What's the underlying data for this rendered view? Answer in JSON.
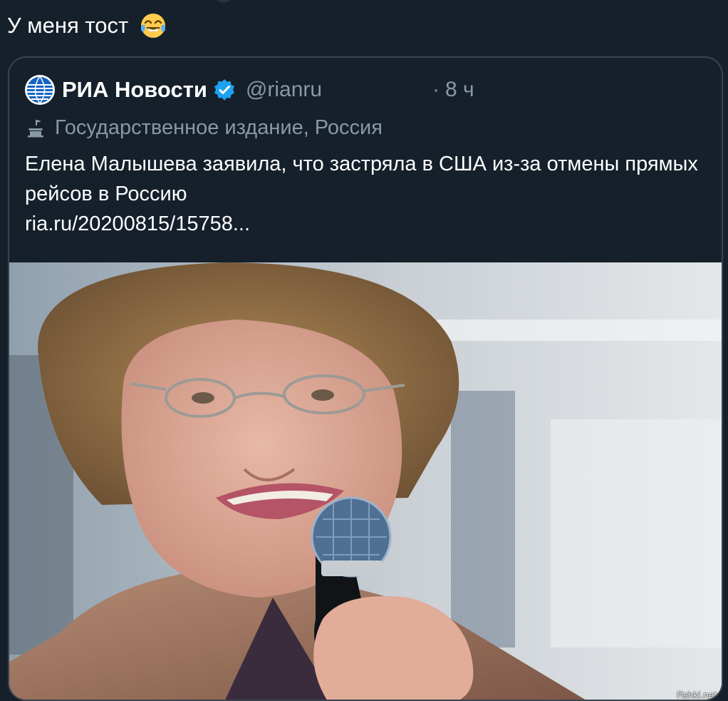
{
  "tweet": {
    "text": "У меня тост",
    "emoji": "face-with-tears-of-joy-emoji"
  },
  "quoted_tweet": {
    "author_name": "РИА Новости",
    "verified": true,
    "handle": "@rianru",
    "time_separator": "·",
    "time": "8 ч",
    "affiliation_icon": "government-building-icon",
    "affiliation_label": "Государственное издание, Россия",
    "text": "Елена Малышева заявила, что застряла в США из-за отмены прямых рейсов в Россию",
    "link": "ria.ru/20200815/15758..."
  },
  "watermark": "Fishki.net",
  "colors": {
    "background": "#15202b",
    "border": "#38444d",
    "secondary_text": "#8899a6",
    "verified_badge": "#1da1f2",
    "ria_logo_blue": "#1565c0"
  }
}
